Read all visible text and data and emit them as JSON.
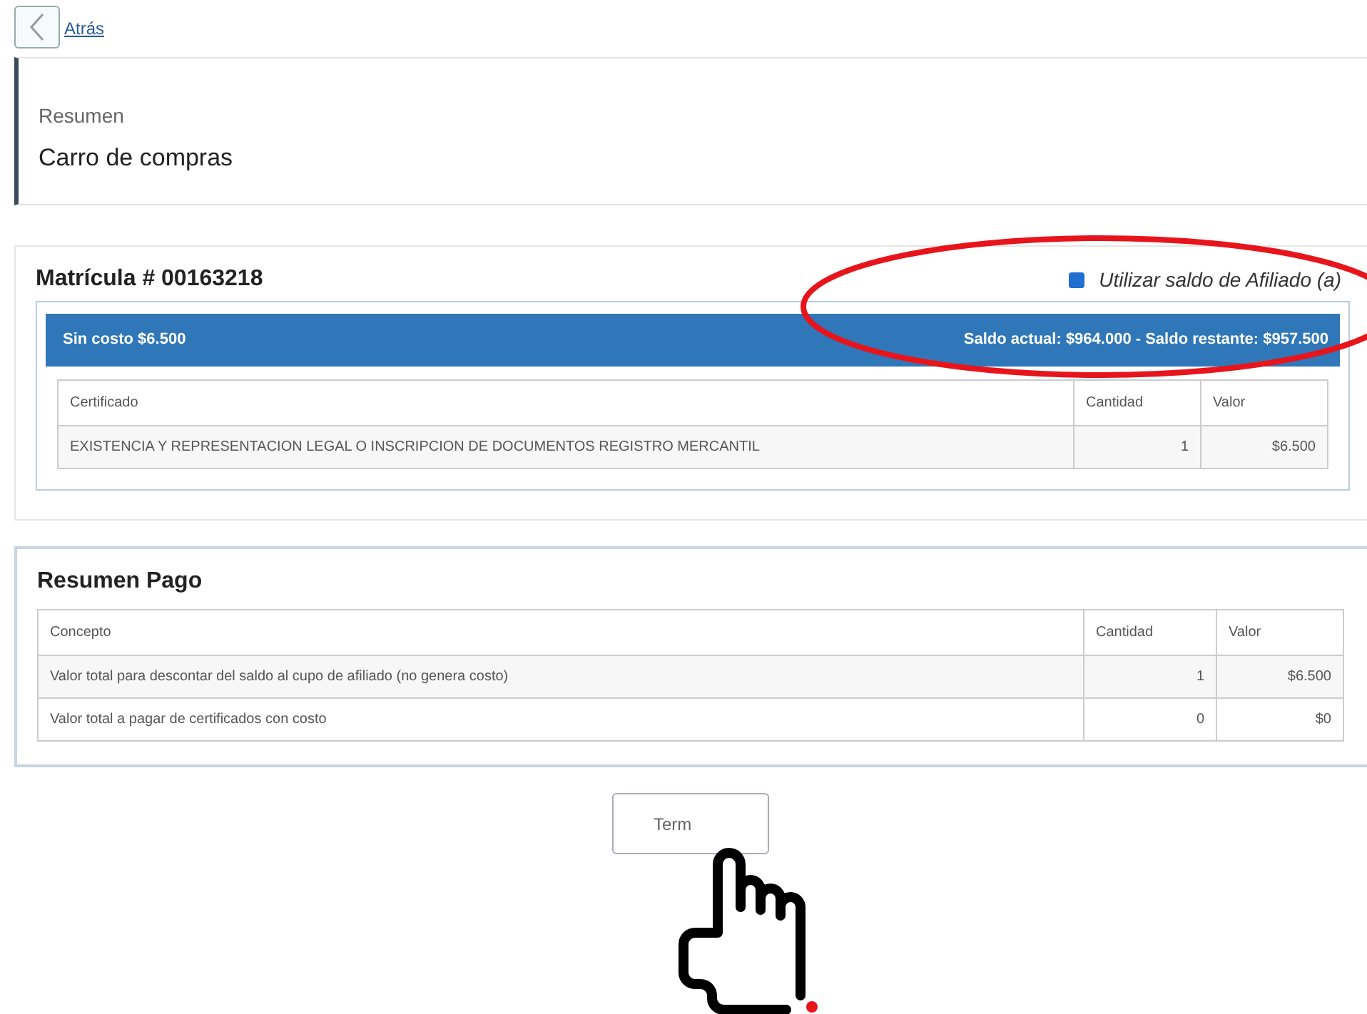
{
  "back_link": "Atrás",
  "header": {
    "subtitle": "Resumen",
    "title": "Carro de compras"
  },
  "registration": {
    "title": "Matrícula # 00163218",
    "use_balance": {
      "label": "Utilizar saldo de Afiliado (a)",
      "checked": true
    },
    "bar": {
      "left": "Sin costo $6.500",
      "right": "Saldo actual: $964.000 - Saldo restante: $957.500"
    },
    "table": {
      "columns": [
        "Certificado",
        "Cantidad",
        "Valor"
      ],
      "rows": [
        [
          "EXISTENCIA Y REPRESENTACION LEGAL O INSCRIPCION DE DOCUMENTOS REGISTRO MERCANTIL",
          "1",
          "$6.500"
        ]
      ]
    }
  },
  "payment": {
    "title": "Resumen Pago",
    "table": {
      "columns": [
        "Concepto",
        "Cantidad",
        "Valor"
      ],
      "rows": [
        [
          "Valor total para descontar del saldo al cupo de afiliado (no genera costo)",
          "1",
          "$6.500"
        ],
        [
          "Valor total a pagar de certificados con costo",
          "0",
          "$0"
        ]
      ]
    }
  },
  "finish_button": "Term"
}
